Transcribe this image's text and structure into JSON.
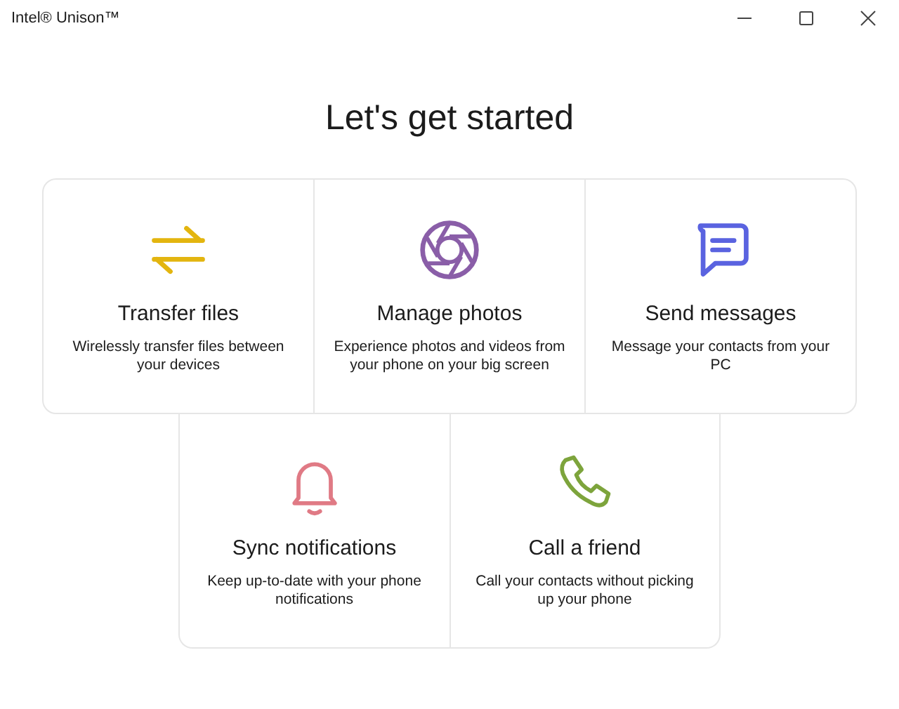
{
  "window": {
    "title": "Intel® Unison™"
  },
  "heading": "Let's get started",
  "rows": [
    {
      "cards": [
        {
          "kind": "transfer",
          "color": "#e3b50f",
          "title": "Transfer files",
          "description": "Wirelessly transfer files between your devices"
        },
        {
          "kind": "photos",
          "color": "#8a5ea8",
          "title": "Manage photos",
          "description": "Experience photos and videos from your phone on your big screen"
        },
        {
          "kind": "messages",
          "color": "#5a63e0",
          "title": "Send messages",
          "description": "Message your contacts from your PC"
        }
      ]
    },
    {
      "cards": [
        {
          "kind": "notifications",
          "color": "#e07a85",
          "title": "Sync notifications",
          "description": "Keep up-to-date with your phone notifications"
        },
        {
          "kind": "call",
          "color": "#7da43c",
          "title": "Call a friend",
          "description": "Call your contacts without picking up your phone"
        }
      ]
    }
  ]
}
